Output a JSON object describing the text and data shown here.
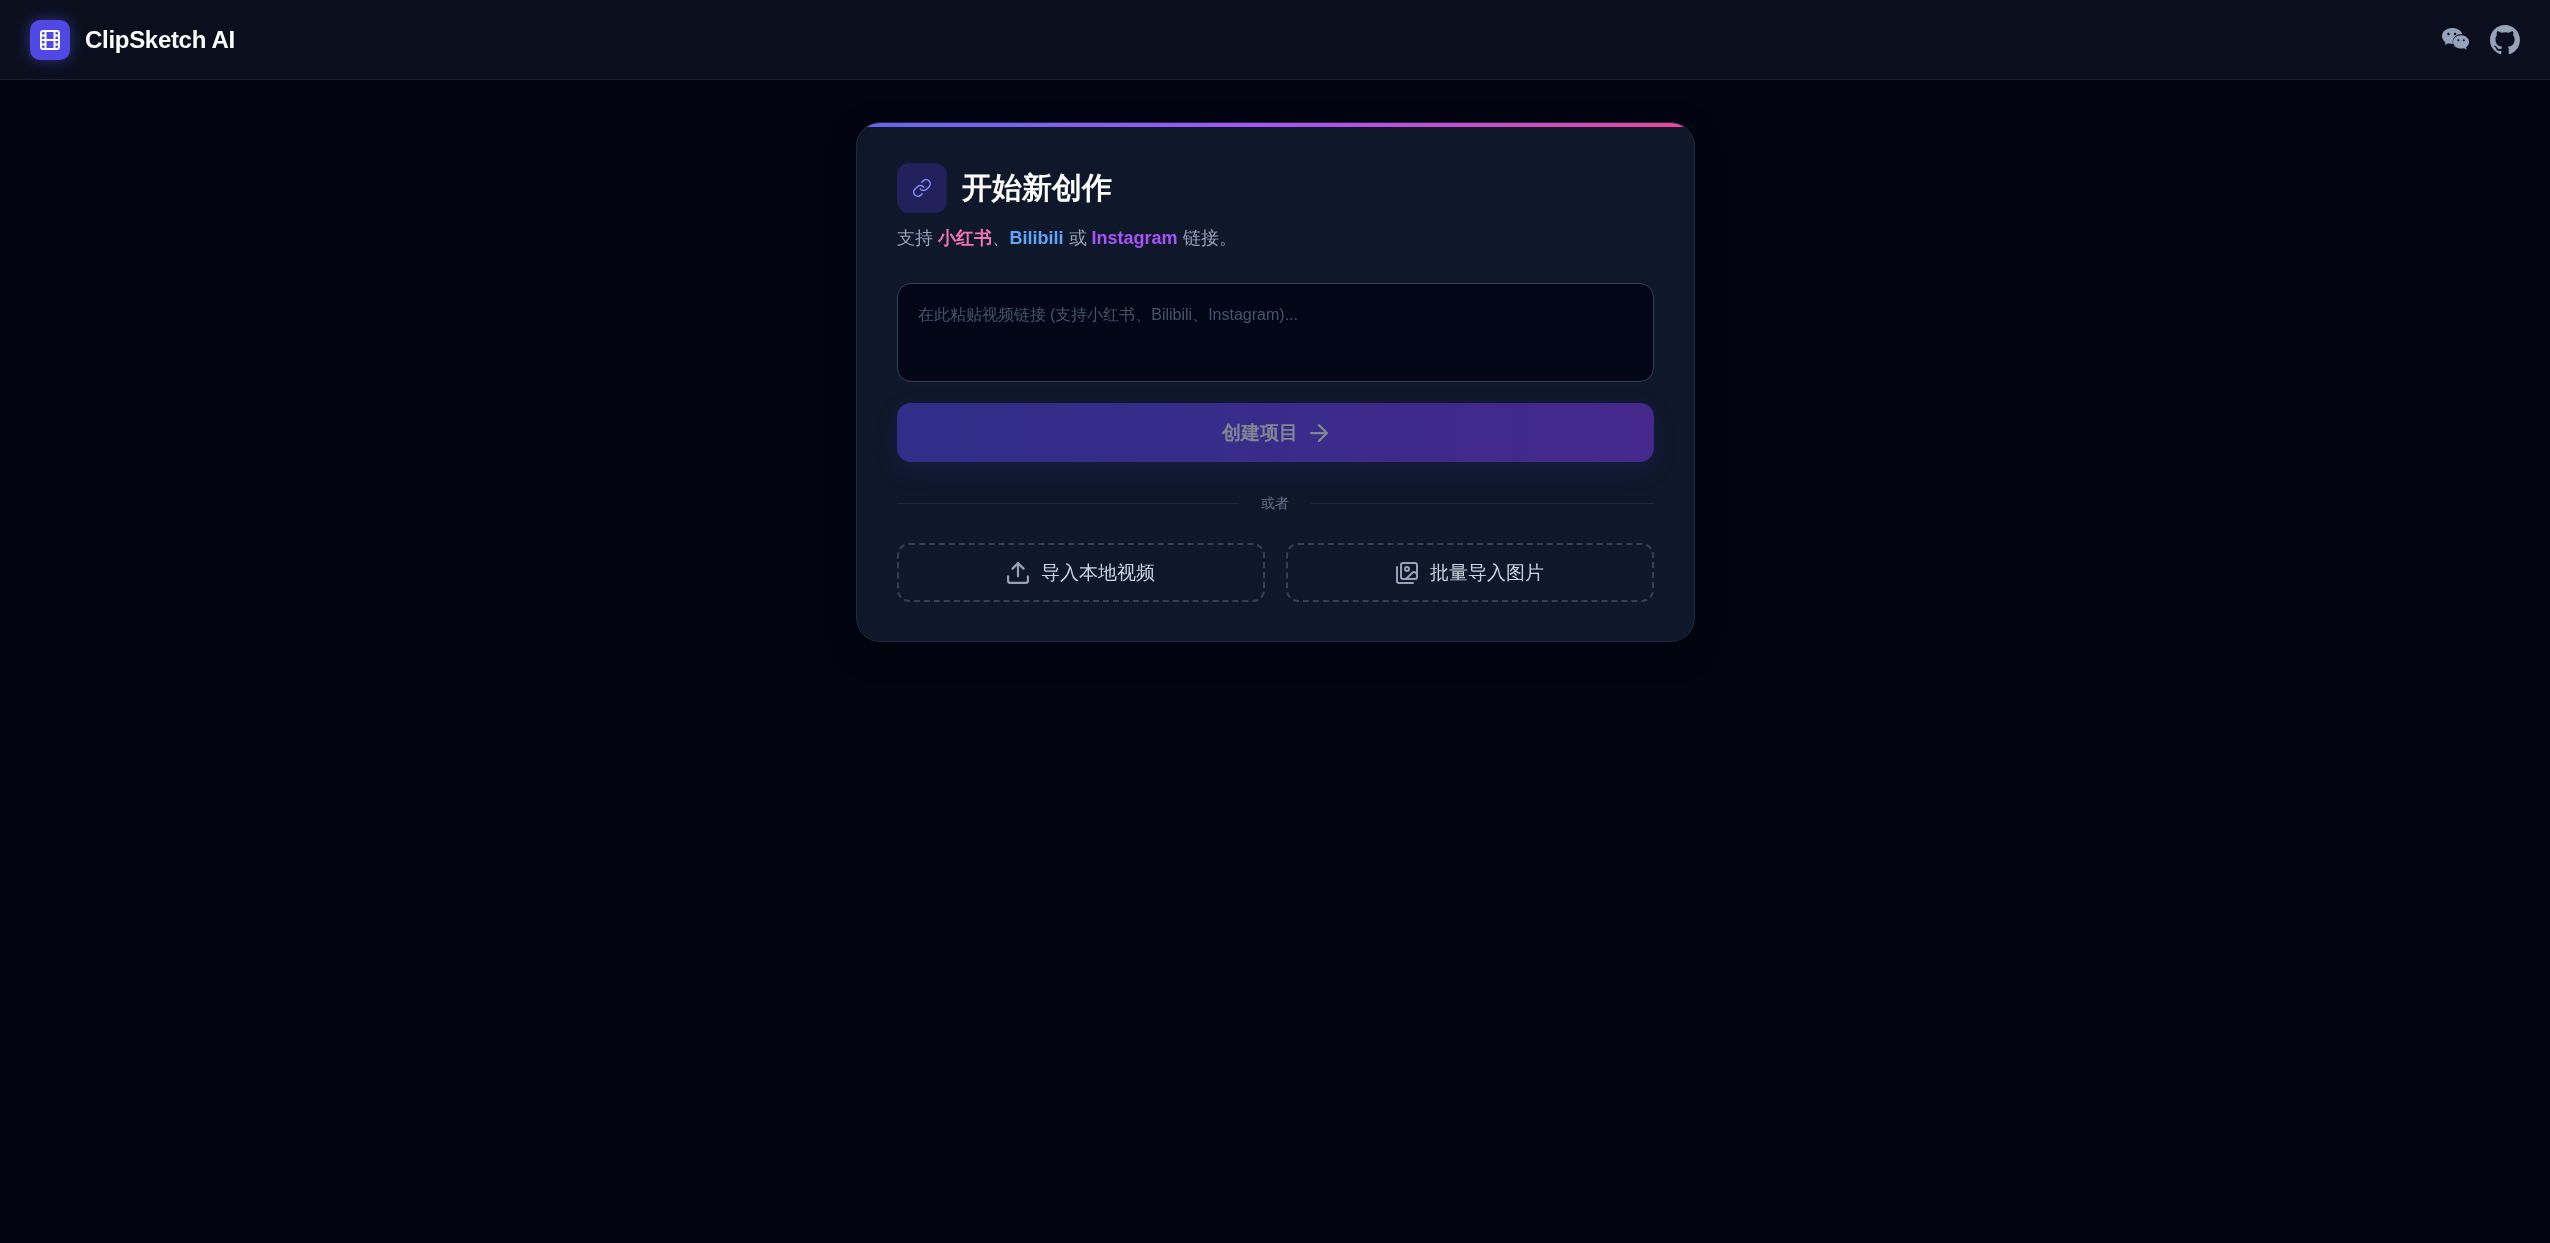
{
  "header": {
    "logo_title": "ClipSketch AI"
  },
  "card": {
    "title": "开始新创作",
    "subtitle_parts": [
      {
        "kind": "plain",
        "text": "支持 "
      },
      {
        "kind": "platform",
        "text": "小红书",
        "color": "#f472b6"
      },
      {
        "kind": "plain",
        "text": "、"
      },
      {
        "kind": "platform",
        "text": "Bilibili",
        "color": "#60a5fa"
      },
      {
        "kind": "plain",
        "text": " 或 "
      },
      {
        "kind": "platform",
        "text": "Instagram",
        "color": "#a855f7"
      },
      {
        "kind": "plain",
        "text": " 链接。"
      }
    ],
    "url_input": {
      "placeholder": "在此粘贴视频链接 (支持小红书、Bilibili、Instagram)..."
    },
    "create_button": {
      "label": "创建项目",
      "disabled": true
    },
    "divider_label": "或者",
    "import_buttons": [
      {
        "kind": "upload",
        "label": "导入本地视频"
      },
      {
        "kind": "images",
        "label": "批量导入图片"
      }
    ]
  }
}
